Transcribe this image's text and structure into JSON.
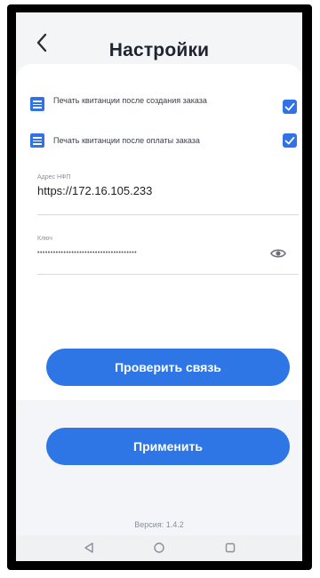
{
  "header": {
    "title": "Настройки"
  },
  "settings": {
    "print_after_create": {
      "label": "Печать квитанции после создания заказа",
      "checked": true
    },
    "print_after_payment": {
      "label": "Печать квитанции после оплаты заказа",
      "checked": true
    },
    "address": {
      "caption": "Адрес НФП",
      "value": "https://172.16.105.233"
    },
    "key": {
      "caption": "Ключ",
      "value": "••••••••••••••••••••••••••••••••••••••"
    }
  },
  "buttons": {
    "check_connection": "Проверить связь",
    "apply": "Применить"
  },
  "footer": {
    "version": "Версия: 1.4.2"
  },
  "colors": {
    "accent": "#2e76e6",
    "background": "#f3f5f8",
    "card": "#ffffff",
    "bezel": "#000000"
  },
  "icons": {
    "back": "chevron-left-icon",
    "list": "list-icon",
    "checkbox": "checkbox-checked-icon",
    "eye": "eye-icon",
    "nav_back": "triangle-back-icon",
    "nav_home": "circle-home-icon",
    "nav_recents": "square-recents-icon"
  }
}
